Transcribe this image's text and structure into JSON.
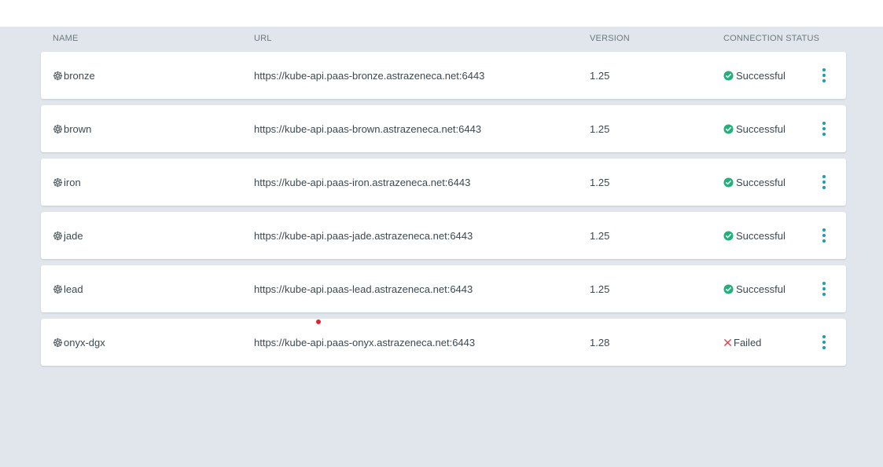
{
  "header": {
    "name": "NAME",
    "url": "URL",
    "version": "VERSION",
    "status": "CONNECTION STATUS"
  },
  "colors": {
    "success": "#22b07d",
    "failed": "#e0404a",
    "accent": "#1a9bab",
    "panel_bg": "#e0e6eb"
  },
  "icons": {
    "cluster": "kubernetes-helm-icon",
    "success": "check-circle-icon",
    "failed": "x-icon",
    "menu": "more-vertical-icon"
  },
  "rows": [
    {
      "name": "bronze",
      "url": "https://kube-api.paas-bronze.astrazeneca.net:6443",
      "version": "1.25",
      "status": "Successful"
    },
    {
      "name": "brown",
      "url": "https://kube-api.paas-brown.astrazeneca.net:6443",
      "version": "1.25",
      "status": "Successful"
    },
    {
      "name": "iron",
      "url": "https://kube-api.paas-iron.astrazeneca.net:6443",
      "version": "1.25",
      "status": "Successful"
    },
    {
      "name": "jade",
      "url": "https://kube-api.paas-jade.astrazeneca.net:6443",
      "version": "1.25",
      "status": "Successful"
    },
    {
      "name": "lead",
      "url": "https://kube-api.paas-lead.astrazeneca.net:6443",
      "version": "1.25",
      "status": "Successful"
    },
    {
      "name": "onyx-dgx",
      "url": "https://kube-api.paas-onyx.astrazeneca.net:6443",
      "version": "1.28",
      "status": "Failed"
    }
  ]
}
